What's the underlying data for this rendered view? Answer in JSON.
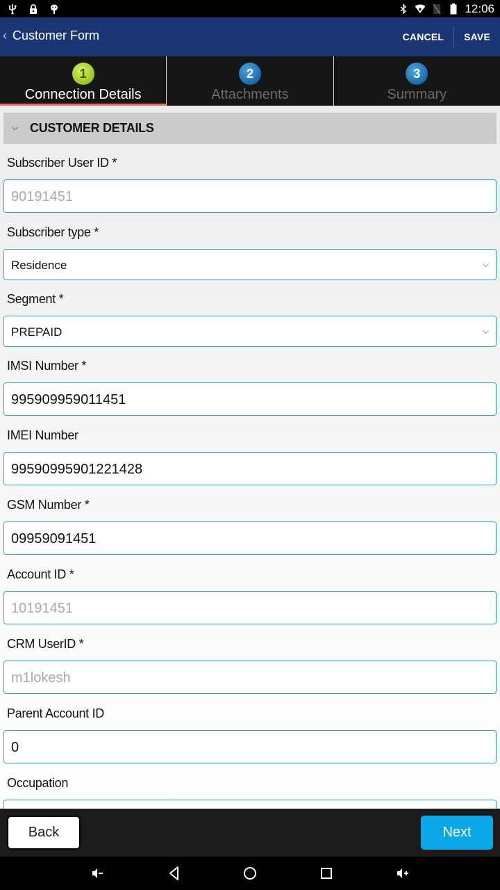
{
  "status_bar": {
    "left_icons": [
      "usb-icon",
      "lock-icon",
      "android-debug-icon"
    ],
    "right_icons": [
      "bluetooth-icon",
      "wifi-icon",
      "no-sim-icon",
      "battery-icon"
    ],
    "time": "12:06"
  },
  "app_bar": {
    "back_icon": "chevron-left-icon",
    "title": "Customer Form",
    "cancel_label": "CANCEL",
    "save_label": "SAVE"
  },
  "steps": [
    {
      "number": "1",
      "label": "Connection Details",
      "active": true,
      "color": "#9cc21d"
    },
    {
      "number": "2",
      "label": "Attachments",
      "active": false,
      "color": "#1a6aa8"
    },
    {
      "number": "3",
      "label": "Summary",
      "active": false,
      "color": "#1a6aa8"
    }
  ],
  "section": {
    "title": "CUSTOMER DETAILS",
    "expanded": true
  },
  "fields": [
    {
      "label": "Subscriber User ID *",
      "value": "90191451",
      "type": "text",
      "placeholder_style": true
    },
    {
      "label": "Subscriber type *",
      "value": "Residence",
      "type": "select"
    },
    {
      "label": "Segment *",
      "value": "PREPAID",
      "type": "select"
    },
    {
      "label": "IMSI Number *",
      "value": "995909959011451",
      "type": "text"
    },
    {
      "label": "IMEI Number",
      "value": "99590995901221428",
      "type": "text"
    },
    {
      "label": "GSM Number *",
      "value": "09959091451",
      "type": "text"
    },
    {
      "label": "Account ID *",
      "value": "10191451",
      "type": "text",
      "placeholder_style": true
    },
    {
      "label": "CRM UserID *",
      "value": "m1lokesh",
      "type": "text",
      "placeholder_style": true
    },
    {
      "label": "Parent Account ID",
      "value": "0",
      "type": "text"
    },
    {
      "label": "Occupation",
      "value": "",
      "type": "text"
    }
  ],
  "bottom_bar": {
    "back_label": "Back",
    "next_label": "Next"
  },
  "nav_bar": [
    "volume-down-icon",
    "back-icon",
    "home-icon",
    "recents-icon",
    "volume-up-icon"
  ],
  "colors": {
    "app_bar": "#1b3575",
    "accent": "#29a3d0",
    "next_button": "#0aa8e8",
    "active_tab_underline": "#e0735b"
  }
}
